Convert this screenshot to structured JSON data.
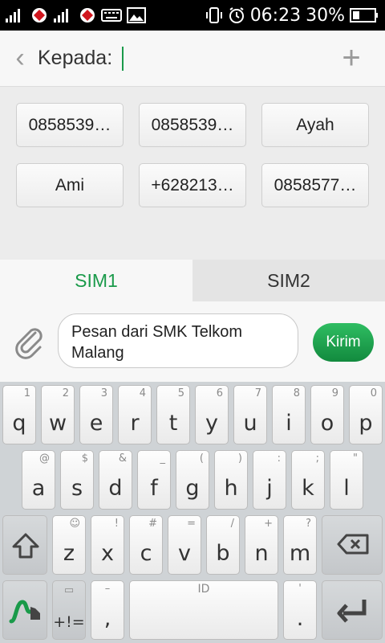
{
  "status_bar": {
    "time": "06:23",
    "battery": "30%",
    "left_icons": [
      "signal-icon",
      "operator-logo-icon",
      "signal-icon",
      "operator-logo-icon",
      "keyboard-icon",
      "image-icon"
    ],
    "right_icons": [
      "vibrate-icon",
      "alarm-icon",
      "battery-icon"
    ]
  },
  "header": {
    "to_label": "Kepada:",
    "back_icon": "back-icon",
    "add_icon": "plus-icon"
  },
  "contacts": [
    "0858539…",
    "0858539…",
    "Ayah",
    "Ami",
    "+628213…",
    "0858577…"
  ],
  "sim_tabs": [
    "SIM1",
    "SIM2"
  ],
  "compose": {
    "message": "Pesan dari SMK Telkom Malang",
    "send_label": "Kirim",
    "attach_icon": "paperclip-icon"
  },
  "keyboard": {
    "row1": [
      {
        "k": "q",
        "h": "1"
      },
      {
        "k": "w",
        "h": "2"
      },
      {
        "k": "e",
        "h": "3"
      },
      {
        "k": "r",
        "h": "4"
      },
      {
        "k": "t",
        "h": "5"
      },
      {
        "k": "y",
        "h": "6"
      },
      {
        "k": "u",
        "h": "7"
      },
      {
        "k": "i",
        "h": "8"
      },
      {
        "k": "o",
        "h": "9"
      },
      {
        "k": "p",
        "h": "0"
      }
    ],
    "row2": [
      {
        "k": "a",
        "h": "@"
      },
      {
        "k": "s",
        "h": "$"
      },
      {
        "k": "d",
        "h": "&"
      },
      {
        "k": "f",
        "h": "_"
      },
      {
        "k": "g",
        "h": "("
      },
      {
        "k": "h",
        "h": ")"
      },
      {
        "k": "j",
        "h": ":"
      },
      {
        "k": "k",
        "h": ";"
      },
      {
        "k": "l",
        "h": "\""
      }
    ],
    "row3": [
      {
        "k": "z",
        "h": "☺"
      },
      {
        "k": "x",
        "h": "!"
      },
      {
        "k": "c",
        "h": "#"
      },
      {
        "k": "v",
        "h": "="
      },
      {
        "k": "b",
        "h": "/"
      },
      {
        "k": "n",
        "h": "+"
      },
      {
        "k": "m",
        "h": "?"
      }
    ],
    "symbols_label": "+!=",
    "comma": ",",
    "comma_hint": "–",
    "space_hint": "ID",
    "period": ".",
    "period_hint": "'",
    "shift_icon": "shift-icon",
    "backspace_icon": "backspace-icon",
    "enter_icon": "enter-icon",
    "swype_icon": "swype-icon"
  }
}
